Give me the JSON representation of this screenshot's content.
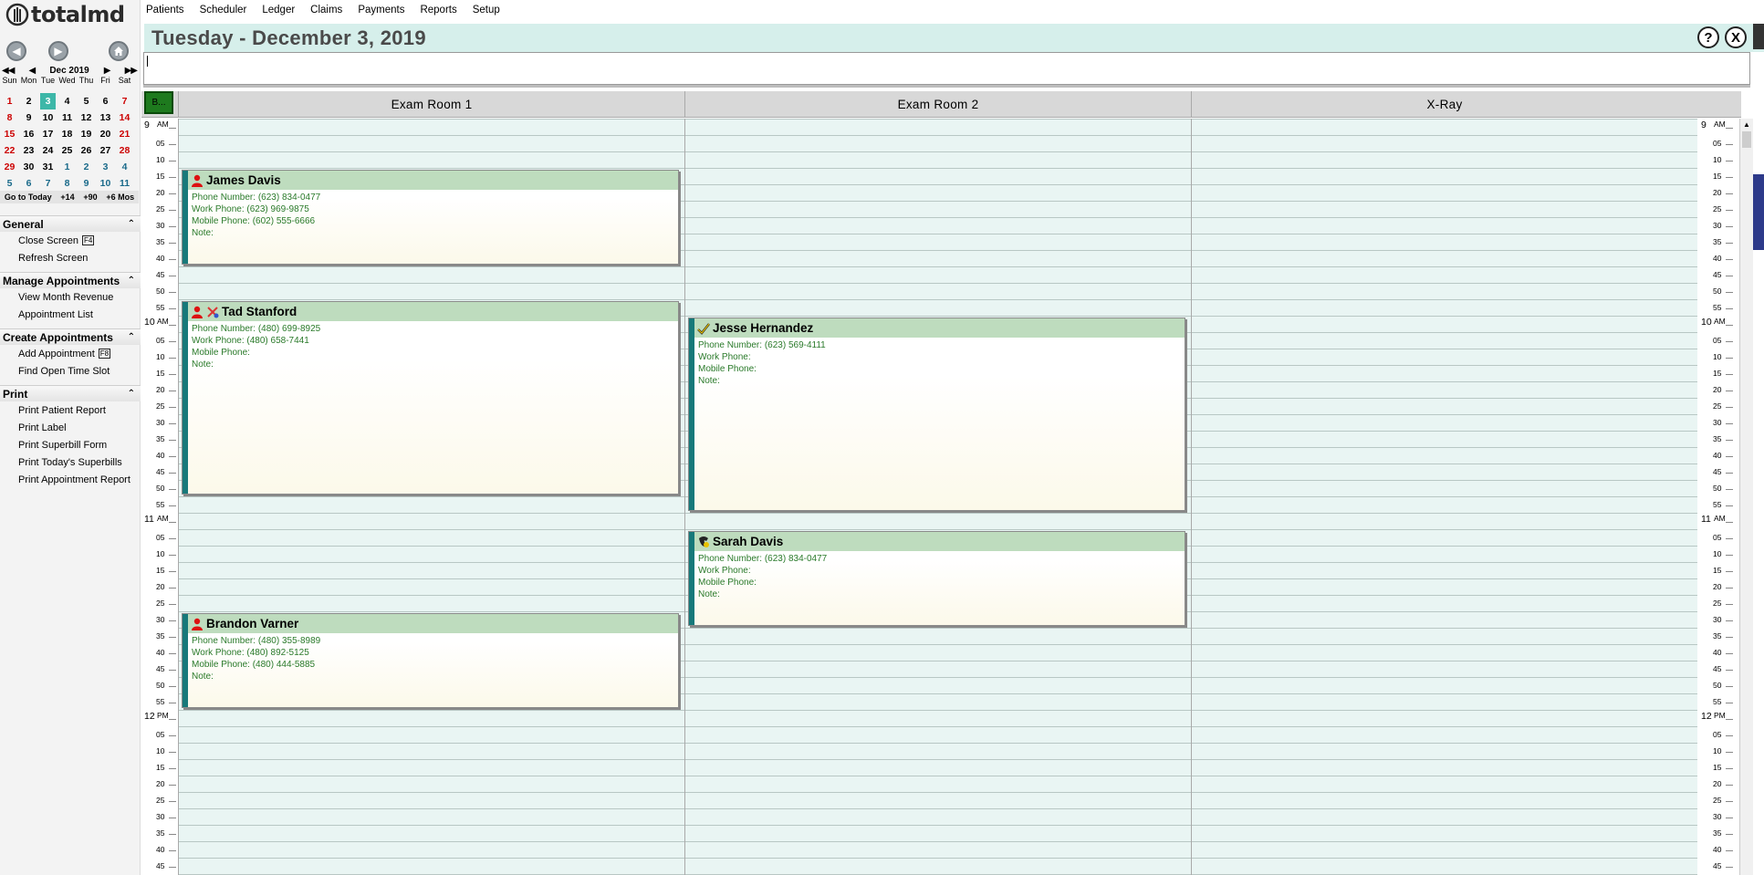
{
  "app": {
    "logo_text": "totalmd"
  },
  "menu": [
    "Patients",
    "Scheduler",
    "Ledger",
    "Claims",
    "Payments",
    "Reports",
    "Setup"
  ],
  "header": {
    "date_title": "Tuesday - December 3, 2019",
    "help_label": "?",
    "close_label": "X"
  },
  "calendar": {
    "month_label": "Dec 2019",
    "prev_year": "◀◀",
    "prev_month": "◀",
    "next_month": "▶",
    "next_year": "▶▶",
    "dow": [
      "Sun",
      "Mon",
      "Tue",
      "Wed",
      "Thu",
      "Fri",
      "Sat"
    ],
    "weeks": [
      [
        "1",
        "2",
        "3",
        "4",
        "5",
        "6",
        "7"
      ],
      [
        "8",
        "9",
        "10",
        "11",
        "12",
        "13",
        "14"
      ],
      [
        "15",
        "16",
        "17",
        "18",
        "19",
        "20",
        "21"
      ],
      [
        "22",
        "23",
        "24",
        "25",
        "26",
        "27",
        "28"
      ],
      [
        "29",
        "30",
        "31",
        "1",
        "2",
        "3",
        "4"
      ],
      [
        "5",
        "6",
        "7",
        "8",
        "9",
        "10",
        "11"
      ]
    ],
    "today": "3",
    "footer": [
      "Go to Today",
      "+14",
      "+90",
      "+6 Mos"
    ]
  },
  "sidebar": {
    "sections": [
      {
        "title": "General",
        "items": [
          {
            "label": "Close Screen",
            "key": "F4"
          },
          {
            "label": "Refresh Screen",
            "key": ""
          }
        ]
      },
      {
        "title": "Manage Appointments",
        "items": [
          {
            "label": "View Month Revenue",
            "key": ""
          },
          {
            "label": "Appointment List",
            "key": ""
          }
        ]
      },
      {
        "title": "Create Appointments",
        "items": [
          {
            "label": "Add Appointment",
            "key": "F8"
          },
          {
            "label": "Find Open Time Slot",
            "key": ""
          }
        ]
      },
      {
        "title": "Print",
        "items": [
          {
            "label": "Print Patient Report",
            "key": ""
          },
          {
            "label": "Print Label",
            "key": ""
          },
          {
            "label": "Print Superbill Form",
            "key": ""
          },
          {
            "label": "Print Today's Superbills",
            "key": ""
          },
          {
            "label": "Print Appointment Report",
            "key": ""
          }
        ]
      }
    ]
  },
  "schedule": {
    "corner_label": "B...",
    "rooms": [
      "Exam Room 1",
      "Exam Room 2",
      "X-Ray"
    ],
    "time_labels": [
      {
        "h": "9",
        "ampm": "AM"
      },
      "05",
      "10",
      "15",
      "20",
      "25",
      "30",
      "35",
      "40",
      "45",
      "50",
      "55",
      {
        "h": "10",
        "ampm": "AM"
      },
      "05",
      "10",
      "15",
      "20",
      "25",
      "30",
      "35",
      "40",
      "45",
      "50",
      "55",
      {
        "h": "11",
        "ampm": "AM"
      },
      "05",
      "10",
      "15",
      "20",
      "25",
      "30",
      "35",
      "40",
      "45",
      "50",
      "55",
      {
        "h": "12",
        "ampm": "PM"
      },
      "05",
      "10",
      "15",
      "20",
      "25",
      "30",
      "35",
      "40",
      "45"
    ],
    "current_slot": "55",
    "appointments": [
      {
        "room": 0,
        "name": "James Davis",
        "icon": "person-icon",
        "phone": "Phone Number: (623) 834-0477",
        "work": "Work Phone: (623) 969-9875",
        "mobile": "Mobile Phone: (602) 555-6666",
        "note": "Note:"
      },
      {
        "room": 0,
        "name": "Tad Stanford",
        "icon": "person-icon",
        "phone": "Phone Number: (480) 699-8925",
        "work": "Work Phone: (480) 658-7441",
        "mobile": "Mobile Phone:",
        "note": "Note:"
      },
      {
        "room": 0,
        "name": "Brandon Varner",
        "icon": "person-icon",
        "phone": "Phone Number: (480) 355-8989",
        "work": "Work Phone: (480) 892-5125",
        "mobile": "Mobile Phone: (480) 444-5885",
        "note": "Note:"
      },
      {
        "room": 1,
        "name": "Jesse Hernandez",
        "icon": "checkmark-icon",
        "phone": "Phone Number: (623) 569-4111",
        "work": "Work Phone:",
        "mobile": "Mobile Phone:",
        "note": "Note:"
      },
      {
        "room": 1,
        "name": "Sarah Davis",
        "icon": "phone-icon",
        "phone": "Phone Number: (623) 834-0477",
        "work": "Work Phone:",
        "mobile": "Mobile Phone:",
        "note": "Note:"
      }
    ]
  }
}
